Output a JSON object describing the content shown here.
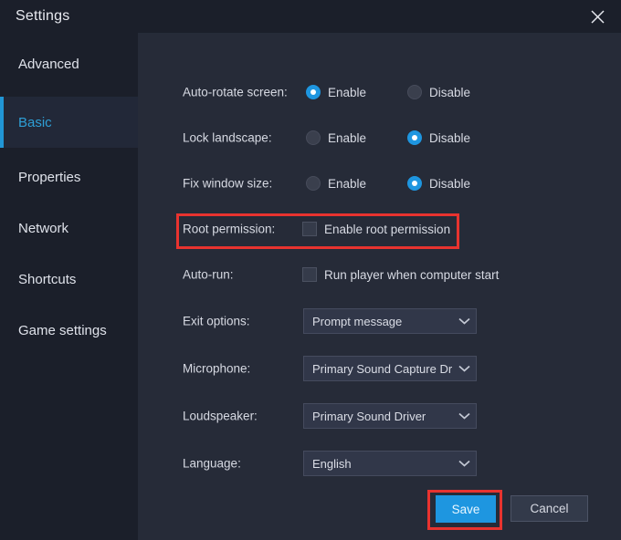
{
  "window": {
    "title": "Settings",
    "close_icon": "close-icon"
  },
  "sidebar": {
    "items": [
      {
        "label": "Advanced",
        "active": false
      },
      {
        "label": "Basic",
        "active": true
      },
      {
        "label": "Properties",
        "active": false
      },
      {
        "label": "Network",
        "active": false
      },
      {
        "label": "Shortcuts",
        "active": false
      },
      {
        "label": "Game settings",
        "active": false
      }
    ]
  },
  "settings": {
    "rows": [
      {
        "label": "Auto-rotate screen:",
        "type": "radio",
        "options": [
          {
            "text": "Enable",
            "selected": true
          },
          {
            "text": "Disable",
            "selected": false
          }
        ]
      },
      {
        "label": "Lock landscape:",
        "type": "radio",
        "options": [
          {
            "text": "Enable",
            "selected": false
          },
          {
            "text": "Disable",
            "selected": true
          }
        ]
      },
      {
        "label": "Fix window size:",
        "type": "radio",
        "options": [
          {
            "text": "Enable",
            "selected": false
          },
          {
            "text": "Disable",
            "selected": true
          }
        ]
      },
      {
        "label": "Root permission:",
        "type": "checkbox",
        "checkbox_text": "Enable root permission",
        "checked": false,
        "highlighted": true
      },
      {
        "label": "Auto-run:",
        "type": "checkbox",
        "checkbox_text": "Run player when computer start",
        "checked": false,
        "highlighted": false
      },
      {
        "label": "Exit options:",
        "type": "select",
        "value": "Prompt message"
      },
      {
        "label": "Microphone:",
        "type": "select",
        "value": "Primary Sound Capture Dr"
      },
      {
        "label": "Loudspeaker:",
        "type": "select",
        "value": "Primary Sound Driver"
      },
      {
        "label": "Language:",
        "type": "select",
        "value": "English"
      }
    ]
  },
  "footer": {
    "save_label": "Save",
    "cancel_label": "Cancel",
    "save_highlighted": true
  },
  "colors": {
    "accent": "#1e96e0",
    "sidebar_bg": "#1b1f2a",
    "content_bg": "#262b38",
    "highlight": "#e8332f",
    "text": "#d7dae3"
  }
}
